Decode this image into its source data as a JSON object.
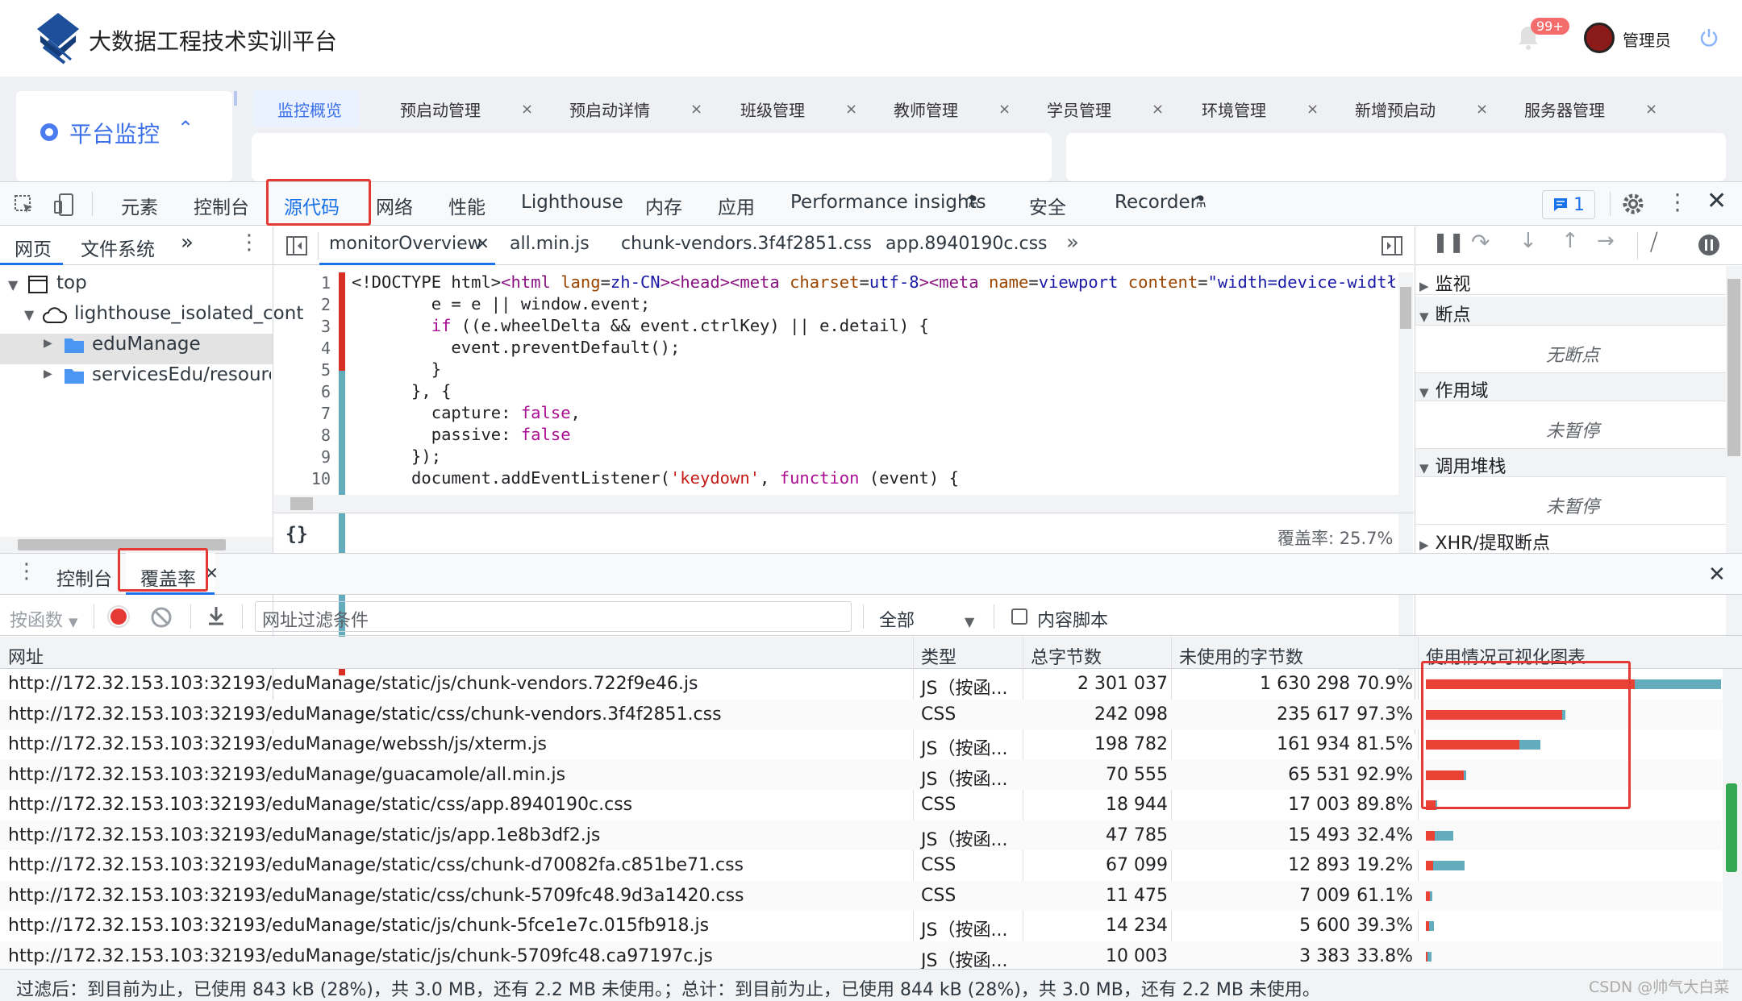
{
  "app": {
    "title": "大数据工程技术实训平台",
    "badge": "99+",
    "user": "管理员",
    "sidebar_menu": "平台监控",
    "tabs": [
      {
        "label": "监控概览",
        "active": true
      },
      {
        "label": "预启动管理"
      },
      {
        "label": "预启动详情"
      },
      {
        "label": "班级管理"
      },
      {
        "label": "教师管理"
      },
      {
        "label": "学员管理"
      },
      {
        "label": "环境管理"
      },
      {
        "label": "新增预启动"
      },
      {
        "label": "服务器管理"
      }
    ]
  },
  "devtools": {
    "main_tabs": [
      "元素",
      "控制台",
      "源代码",
      "网络",
      "性能",
      "Lighthouse",
      "内存",
      "应用",
      "Performance insights",
      "安全",
      "Recorder"
    ],
    "issues_count": "1",
    "nav_tabs": [
      "网页",
      "文件系统"
    ],
    "tree": [
      "top",
      "lighthouse_isolated_cont",
      "eduManage",
      "servicesEdu/resources/"
    ],
    "file_tabs": [
      "monitorOverview",
      "all.min.js",
      "chunk-vendors.3f4f2851.css",
      "app.8940190c.css"
    ],
    "format_btn": "{}",
    "coverage_summary": "覆盖率:  25.7%",
    "line_numbers": [
      "1",
      "2",
      "3",
      "4",
      "5",
      "6",
      "7",
      "8",
      "9",
      "10"
    ],
    "debugger": {
      "watch": "监视",
      "breakpoints": "断点",
      "no_breakpoints": "无断点",
      "scope": "作用域",
      "not_paused": "未暂停",
      "callstack": "调用堆栈",
      "not_paused2": "未暂停",
      "xhr": "XHR/提取断点"
    },
    "drawer_tabs": [
      "控制台",
      "覆盖率"
    ],
    "coverage": {
      "mode": "按函数",
      "filter_placeholder": "网址过滤条件",
      "type_select": "全部",
      "content_scripts": "内容脚本",
      "headers": [
        "网址",
        "类型",
        "总字节数",
        "未使用的字节数",
        "使用情况可视化图表"
      ],
      "rows": [
        {
          "url": "http://172.32.153.103:32193/eduManage/static/js/chunk-vendors.722f9e46.js",
          "type": "JS（按函...",
          "total": "2 301 037",
          "unused": "1 630 298",
          "pct": "70.9%",
          "total_n": 2301037,
          "used_frac": 0.291
        },
        {
          "url": "http://172.32.153.103:32193/eduManage/static/css/chunk-vendors.3f4f2851.css",
          "type": "CSS",
          "total": "242 098",
          "unused": "235 617",
          "pct": "97.3%",
          "total_n": 242098,
          "used_frac": 0.027
        },
        {
          "url": "http://172.32.153.103:32193/eduManage/webssh/js/xterm.js",
          "type": "JS（按函...",
          "total": "198 782",
          "unused": "161 934",
          "pct": "81.5%",
          "total_n": 198782,
          "used_frac": 0.185
        },
        {
          "url": "http://172.32.153.103:32193/eduManage/guacamole/all.min.js",
          "type": "JS（按函...",
          "total": "70 555",
          "unused": "65 531",
          "pct": "92.9%",
          "total_n": 70555,
          "used_frac": 0.071
        },
        {
          "url": "http://172.32.153.103:32193/eduManage/static/css/app.8940190c.css",
          "type": "CSS",
          "total": "18 944",
          "unused": "17 003",
          "pct": "89.8%",
          "total_n": 18944,
          "used_frac": 0.102
        },
        {
          "url": "http://172.32.153.103:32193/eduManage/static/js/app.1e8b3df2.js",
          "type": "JS（按函...",
          "total": "47 785",
          "unused": "15 493",
          "pct": "32.4%",
          "total_n": 47785,
          "used_frac": 0.676
        },
        {
          "url": "http://172.32.153.103:32193/eduManage/static/css/chunk-d70082fa.c851be71.css",
          "type": "CSS",
          "total": "67 099",
          "unused": "12 893",
          "pct": "19.2%",
          "total_n": 67099,
          "used_frac": 0.808
        },
        {
          "url": "http://172.32.153.103:32193/eduManage/static/css/chunk-5709fc48.9d3a1420.css",
          "type": "CSS",
          "total": "11 475",
          "unused": "7 009",
          "pct": "61.1%",
          "total_n": 11475,
          "used_frac": 0.389
        },
        {
          "url": "http://172.32.153.103:32193/eduManage/static/js/chunk-5fce1e7c.015fb918.js",
          "type": "JS（按函...",
          "total": "14 234",
          "unused": "5 600",
          "pct": "39.3%",
          "total_n": 14234,
          "used_frac": 0.607
        },
        {
          "url": "http://172.32.153.103:32193/eduManage/static/js/chunk-5709fc48.ca97197c.js",
          "type": "JS（按函...",
          "total": "10 003",
          "unused": "3 383",
          "pct": "33.8%",
          "total_n": 10003,
          "used_frac": 0.662
        }
      ],
      "status": "过滤后：到目前为止，已使用 843 kB (28%)，共 3.0 MB，还有 2.2 MB 未使用。；总计：到目前为止，已使用 844 kB (28%)，共 3.0 MB，还有 2.2 MB 未使用。",
      "watermark": "CSDN @帅气大白菜"
    }
  },
  "colors": {
    "unused": "#ea4335",
    "used": "#63acbe",
    "accent": "#1a73e8",
    "highlight": "#e53935"
  }
}
